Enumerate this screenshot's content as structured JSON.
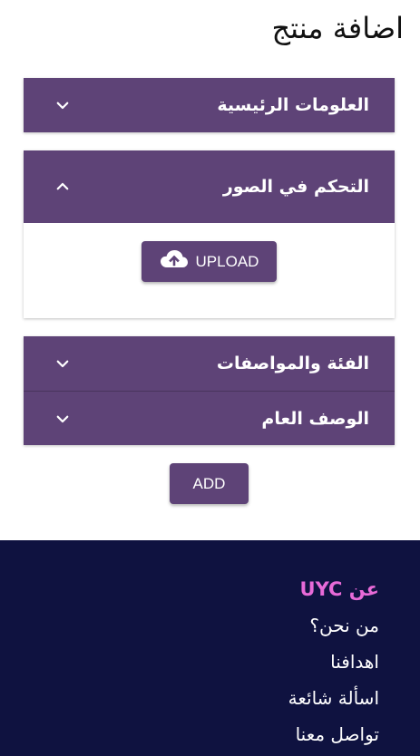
{
  "page": {
    "title": "اضافة منتج"
  },
  "accordions": [
    {
      "label": "العلومات الرئيسية",
      "expanded": false,
      "icon": "chevron-down-icon"
    },
    {
      "label": "التحكم في الصور",
      "expanded": true,
      "icon": "chevron-up-icon"
    },
    {
      "label": "الفئة والمواصفات",
      "expanded": false,
      "icon": "chevron-down-icon"
    },
    {
      "label": "الوصف العام",
      "expanded": false,
      "icon": "chevron-down-icon"
    }
  ],
  "upload": {
    "label": "UPLOAD",
    "icon": "cloud-upload-icon"
  },
  "actions": {
    "add_label": "ADD"
  },
  "footer": {
    "heading": "عن UYC",
    "links": [
      "من نحن؟",
      "اهدافنا",
      "اسألة شائعة",
      "تواصل معنا"
    ]
  },
  "colors": {
    "accent": "#5e4377",
    "footer_bg": "#0f1240",
    "footer_heading": "#e86ad8",
    "text_light": "#ffffff"
  }
}
